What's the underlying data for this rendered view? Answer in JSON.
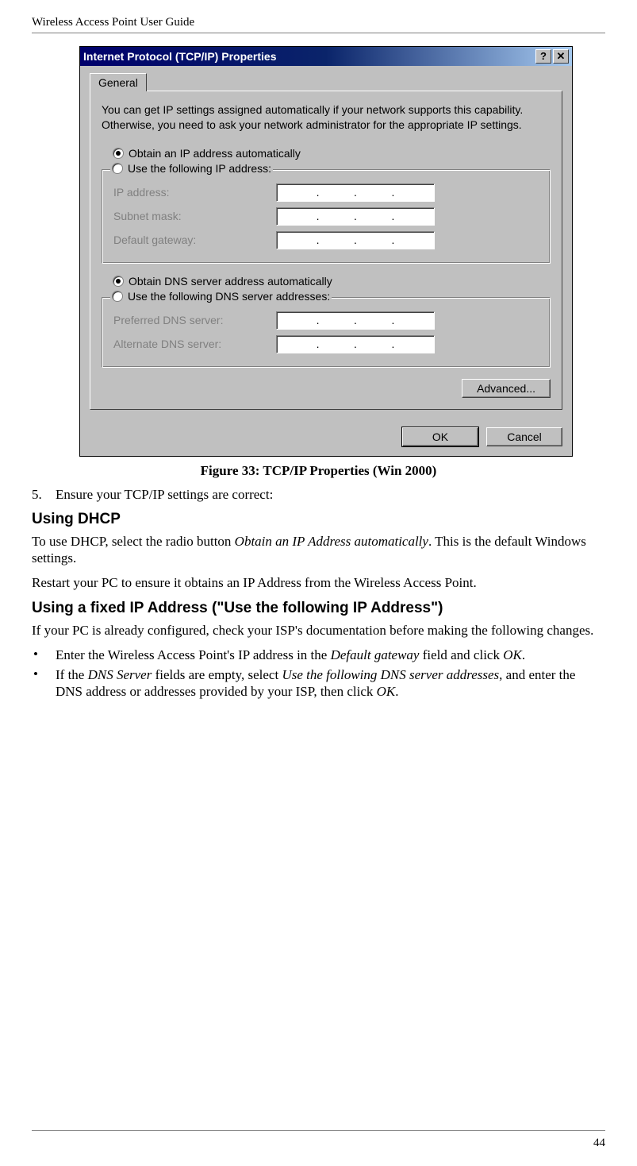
{
  "headerTitle": "Wireless Access Point User Guide",
  "pageNumber": "44",
  "dialog": {
    "title": "Internet Protocol (TCP/IP) Properties",
    "helpGlyph": "?",
    "closeGlyph": "✕",
    "tab": "General",
    "infoText": "You can get IP settings assigned automatically if your network supports this capability. Otherwise, you need to ask your network administrator for the appropriate IP settings.",
    "radioIpAuto": "Obtain an IP address automatically",
    "radioIpManual": "Use the following IP address:",
    "ipFields": {
      "ip": "IP address:",
      "subnet": "Subnet mask:",
      "gateway": "Default gateway:"
    },
    "radioDnsAuto": "Obtain DNS server address automatically",
    "radioDnsManual": "Use the following DNS server addresses:",
    "dnsFields": {
      "pref": "Preferred DNS server:",
      "alt": "Alternate DNS server:"
    },
    "advanced": "Advanced...",
    "ok": "OK",
    "cancel": "Cancel"
  },
  "caption": "Figure 33: TCP/IP Properties (Win 2000)",
  "step5": {
    "num": "5.",
    "text": "Ensure your TCP/IP settings are correct:"
  },
  "section1": {
    "heading": "Using DHCP",
    "p1_a": "To use DHCP, select the radio button ",
    "p1_em": "Obtain an IP Address automatically",
    "p1_b": ". This is the default Windows settings.",
    "p2": "Restart your PC to ensure it obtains an IP Address from the Wireless Access Point."
  },
  "section2": {
    "heading": "Using a fixed IP Address (\"Use the following IP Address\")",
    "intro": "If your PC is already configured, check your ISP's documentation before making the following changes.",
    "bullet1_a": "Enter the Wireless Access Point's IP address in the ",
    "bullet1_em1": "Default gateway",
    "bullet1_b": " field and click ",
    "bullet1_em2": "OK",
    "bullet1_c": ".",
    "bullet2_a": "If the ",
    "bullet2_em1": "DNS Server",
    "bullet2_b": " fields are empty, select ",
    "bullet2_em2": "Use the following DNS server addresses",
    "bullet2_c": ", and enter the DNS address or addresses provided by your ISP, then click ",
    "bullet2_em3": "OK",
    "bullet2_d": "."
  }
}
